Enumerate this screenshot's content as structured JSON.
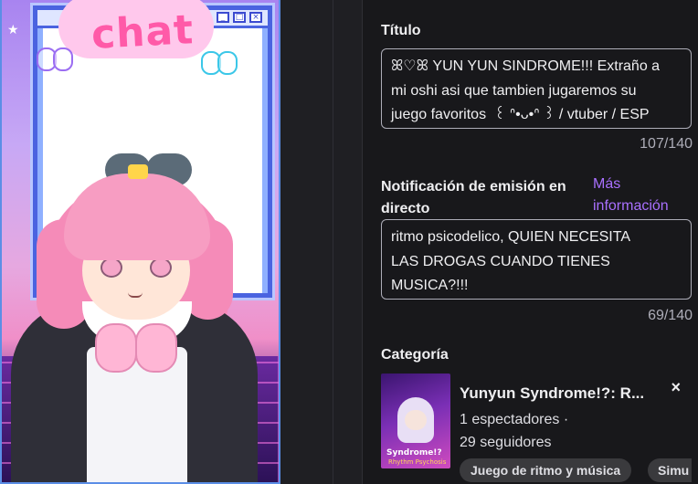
{
  "preview": {
    "chat_word": "chat",
    "window_buttons": [
      "_",
      "□",
      "×"
    ]
  },
  "form": {
    "title": {
      "label": "Título",
      "value": "ꕤ♡ꕤ YUN YUN SINDROME!!! Extraño a\nmi oshi asi que tambien jugaremos su\njuego favoritos  ꒰ ᐢ•ᴗ•ᐢ ꒱ / vtuber / ESP",
      "counter": "107/140"
    },
    "notification": {
      "label_line1": "Notificación de emisión en",
      "label_line2": "directo",
      "more_info_line1": "Más",
      "more_info_line2": "información",
      "value": "ritmo psicodelico, QUIEN NECESITA\nLAS DROGAS CUANDO TIENES\nMUSICA?!!!",
      "counter": "69/140"
    },
    "category": {
      "label": "Categoría",
      "game_title": "Yunyun Syndrome!?: R...",
      "viewers": "1 espectadores  ·",
      "followers": "29 seguidores",
      "close_symbol": "×",
      "cover_logo": "Syndrome!?",
      "cover_sub": "Rhythm Psychosis",
      "tags": [
        "Juego de ritmo y música",
        "Simu"
      ]
    }
  },
  "colors": {
    "background": "#18181b",
    "accent_link": "#a970ff",
    "border": "#adadb8",
    "tag_bg": "#3a3a3d"
  }
}
